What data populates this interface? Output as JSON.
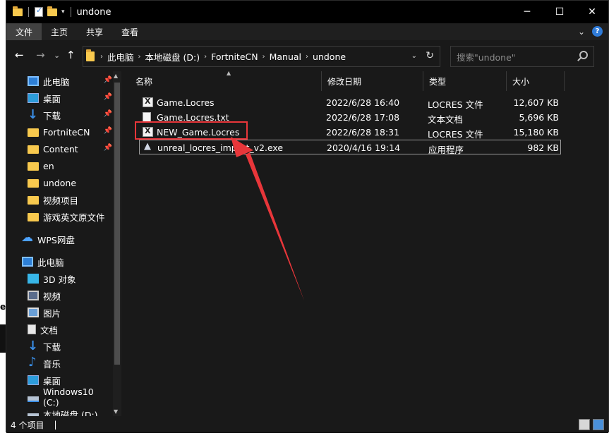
{
  "window": {
    "title": "undone"
  },
  "window_controls": {
    "minimize": "─",
    "maximize": "☐",
    "close": "✕"
  },
  "ribbon": {
    "tabs": [
      "文件",
      "主页",
      "共享",
      "查看"
    ],
    "expand": "⌄",
    "help": "?"
  },
  "nav_buttons": {
    "back": "←",
    "forward": "→",
    "recent": "⌄",
    "up": "↑"
  },
  "address": {
    "crumbs": [
      "此电脑",
      "本地磁盘 (D:)",
      "FortniteCN",
      "Manual",
      "undone"
    ],
    "separator": "›",
    "dropdown": "⌄",
    "refresh": "↻"
  },
  "search": {
    "placeholder": "搜索\"undone\""
  },
  "sidebar": {
    "items": [
      {
        "label": "此电脑",
        "icon": "pc-icon",
        "pinned": true
      },
      {
        "label": "桌面",
        "icon": "desktop-icon",
        "pinned": true
      },
      {
        "label": "下载",
        "icon": "download-icon",
        "pinned": true
      },
      {
        "label": "FortniteCN",
        "icon": "folder-icon",
        "pinned": true
      },
      {
        "label": "Content",
        "icon": "folder-icon",
        "pinned": true
      },
      {
        "label": "en",
        "icon": "folder-icon",
        "pinned": false
      },
      {
        "label": "undone",
        "icon": "folder-icon",
        "pinned": false
      },
      {
        "label": "视频项目",
        "icon": "folder-icon",
        "pinned": false
      },
      {
        "label": "游戏英文原文件",
        "icon": "folder-icon",
        "pinned": false
      },
      {
        "label": "WPS网盘",
        "icon": "cloud-icon",
        "pinned": false
      },
      {
        "label": "此电脑",
        "icon": "pc-icon",
        "pinned": false
      },
      {
        "label": "3D 对象",
        "icon": "3d-objects-icon",
        "pinned": false
      },
      {
        "label": "视频",
        "icon": "video-icon",
        "pinned": false
      },
      {
        "label": "图片",
        "icon": "picture-icon",
        "pinned": false
      },
      {
        "label": "文档",
        "icon": "document-icon",
        "pinned": false
      },
      {
        "label": "下载",
        "icon": "download-icon",
        "pinned": false
      },
      {
        "label": "音乐",
        "icon": "music-icon",
        "pinned": false
      },
      {
        "label": "桌面",
        "icon": "desktop-icon",
        "pinned": false
      },
      {
        "label": "Windows10 (C:)",
        "icon": "drive-icon",
        "pinned": false
      },
      {
        "label": "本地磁盘 (D:)",
        "icon": "drive-icon",
        "pinned": false
      }
    ],
    "pin_glyph": "📌"
  },
  "columns": {
    "name": "名称",
    "modified": "修改日期",
    "type": "类型",
    "size": "大小"
  },
  "files": [
    {
      "name": "Game.Locres",
      "modified": "2022/6/28 16:40",
      "type": "LOCRES 文件",
      "size": "12,607 KB",
      "icon": "locres-file-icon"
    },
    {
      "name": "Game.Locres.txt",
      "modified": "2022/6/28 17:08",
      "type": "文本文档",
      "size": "5,696 KB",
      "icon": "text-file-icon"
    },
    {
      "name": "NEW_Game.Locres",
      "modified": "2022/6/28 18:31",
      "type": "LOCRES 文件",
      "size": "15,180 KB",
      "icon": "locres-file-icon"
    },
    {
      "name": "unreal_locres_import_v2.exe",
      "modified": "2020/4/16 19:14",
      "type": "应用程序",
      "size": "982 KB",
      "icon": "exe-file-icon"
    }
  ],
  "status": {
    "count": "4 个项目",
    "sep": "|"
  },
  "annotation": {
    "color": "#e8363a"
  }
}
